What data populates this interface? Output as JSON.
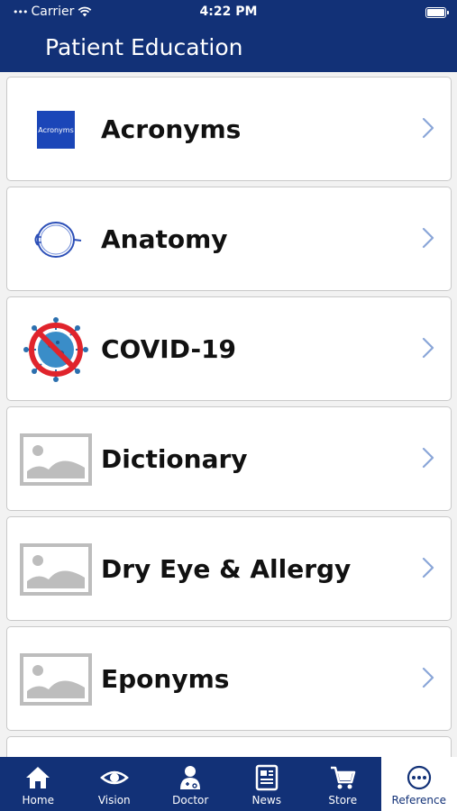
{
  "status_bar": {
    "carrier": "Carrier",
    "time": "4:22 PM"
  },
  "header": {
    "title": "Patient Education"
  },
  "items": [
    {
      "label": "Acronyms",
      "icon": "acronyms-icon",
      "thumb_text": "Acronyms"
    },
    {
      "label": "Anatomy",
      "icon": "eye-anatomy-icon"
    },
    {
      "label": "COVID-19",
      "icon": "no-virus-icon"
    },
    {
      "label": "Dictionary",
      "icon": "image-placeholder-icon"
    },
    {
      "label": "Dry Eye & Allergy",
      "icon": "image-placeholder-icon"
    },
    {
      "label": "Eponyms",
      "icon": "image-placeholder-icon"
    }
  ],
  "tabs": [
    {
      "label": "Home",
      "icon": "home-icon"
    },
    {
      "label": "Vision",
      "icon": "eye-icon"
    },
    {
      "label": "Doctor",
      "icon": "doctor-icon"
    },
    {
      "label": "News",
      "icon": "newspaper-icon"
    },
    {
      "label": "Store",
      "icon": "cart-icon"
    },
    {
      "label": "Reference",
      "icon": "more-icon",
      "active": true
    }
  ],
  "colors": {
    "primary": "#123177",
    "chevron": "#8aa6d8",
    "placeholder": "#bdbdbd"
  }
}
